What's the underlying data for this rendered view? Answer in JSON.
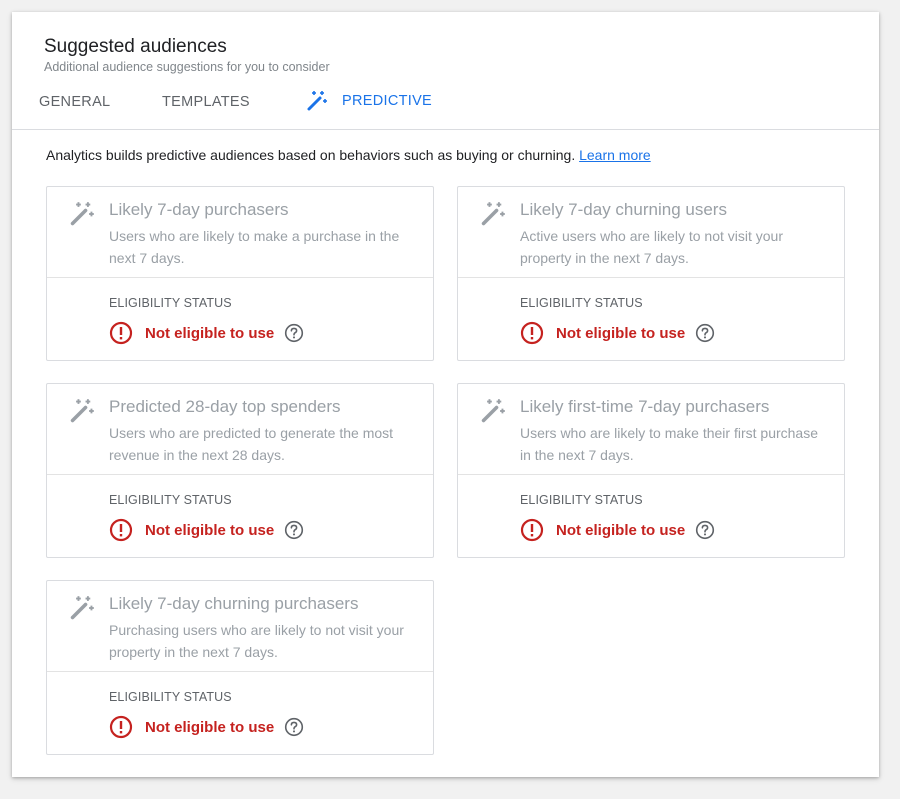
{
  "header": {
    "title": "Suggested audiences",
    "subtitle": "Additional audience suggestions for you to consider"
  },
  "tabs": [
    {
      "label": "GENERAL",
      "active": false
    },
    {
      "label": "TEMPLATES",
      "active": false
    },
    {
      "label": "PREDICTIVE",
      "active": true,
      "icon": "magic-wand-icon"
    }
  ],
  "intro": {
    "text": "Analytics builds predictive audiences based on behaviors such as buying or churning.",
    "link_label": "Learn more"
  },
  "cards": [
    {
      "title": "Likely 7-day purchasers",
      "description": "Users who are likely to make a purchase in the next 7 days.",
      "eligibility_label": "ELIGIBILITY STATUS",
      "status": "Not eligible to use"
    },
    {
      "title": "Likely 7-day churning users",
      "description": "Active users who are likely to not visit your property in the next 7 days.",
      "eligibility_label": "ELIGIBILITY STATUS",
      "status": "Not eligible to use"
    },
    {
      "title": "Predicted 28-day top spenders",
      "description": "Users who are predicted to generate the most revenue in the next 28 days.",
      "eligibility_label": "ELIGIBILITY STATUS",
      "status": "Not eligible to use"
    },
    {
      "title": "Likely first-time 7-day purchasers",
      "description": "Users who are likely to make their first purchase in the next 7 days.",
      "eligibility_label": "ELIGIBILITY STATUS",
      "status": "Not eligible to use"
    },
    {
      "title": "Likely 7-day churning purchasers",
      "description": "Purchasing users who are likely to not visit your property in the next 7 days.",
      "eligibility_label": "ELIGIBILITY STATUS",
      "status": "Not eligible to use"
    }
  ],
  "colors": {
    "accent": "#1a73e8",
    "error": "#c5221f",
    "muted_text": "#9aa0a6",
    "border": "#dadce0"
  }
}
